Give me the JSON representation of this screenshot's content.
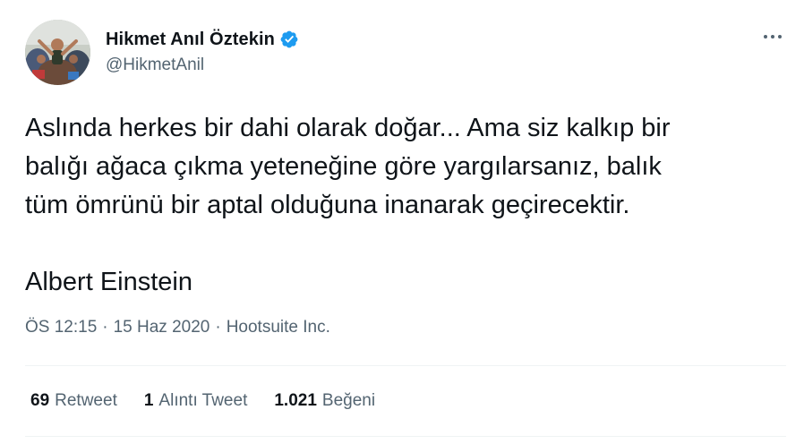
{
  "author": {
    "display_name": "Hikmet Anıl Öztekin",
    "handle": "@HikmetAnil",
    "verified": true
  },
  "tweet": {
    "text": "Aslında herkes bir dahi olarak doğar... Ama siz kalkıp bir\nbalığı ağaca çıkma yeteneğine göre yargılarsanız, balık\ntüm ömrünü bir aptal olduğuna inanarak geçirecektir.\n\nAlbert Einstein"
  },
  "meta": {
    "time": "ÖS 12:15",
    "separator": "·",
    "date": "15 Haz 2020",
    "source": "Hootsuite Inc."
  },
  "stats": {
    "retweets": {
      "count": "69",
      "label": "Retweet"
    },
    "quotes": {
      "count": "1",
      "label": "Alıntı Tweet"
    },
    "likes": {
      "count": "1.021",
      "label": "Beğeni"
    }
  },
  "colors": {
    "text_primary": "#0f1419",
    "text_secondary": "#536471",
    "verified_blue": "#1d9bf0",
    "divider": "#eff3f4"
  },
  "icons": {
    "verified": "verified-badge-icon",
    "more": "more-horizontal-icon"
  }
}
